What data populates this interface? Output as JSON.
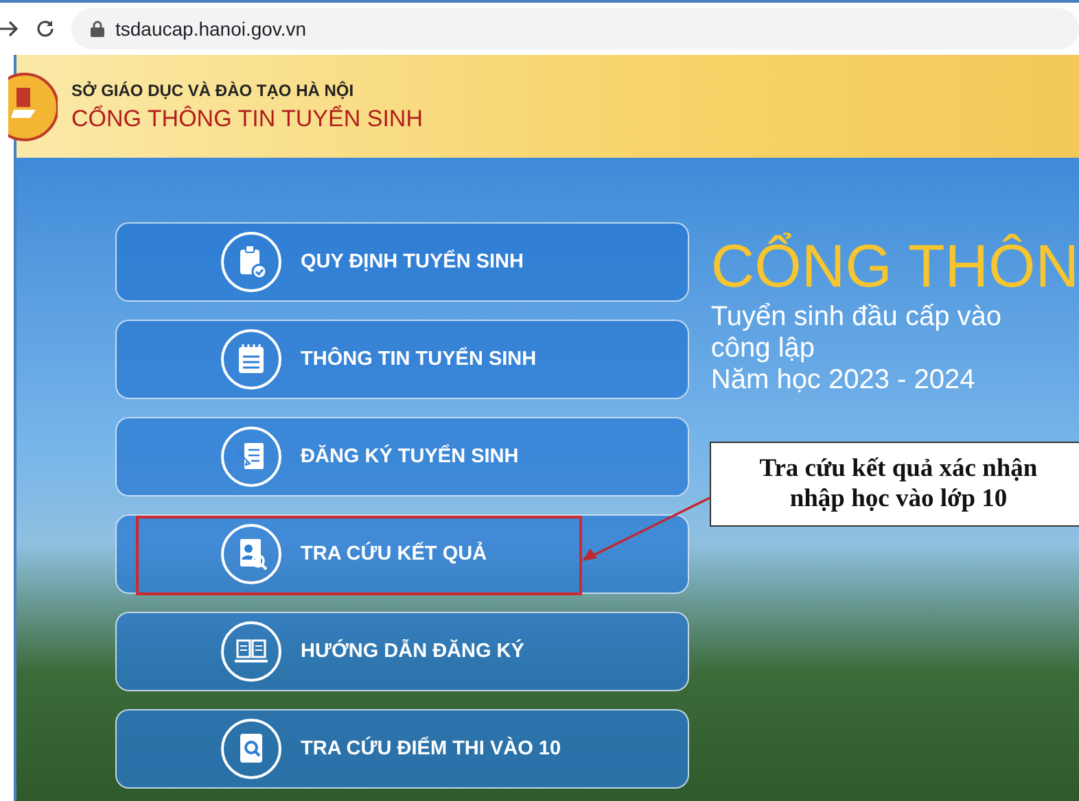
{
  "browser": {
    "url": "tsdaucap.hanoi.gov.vn"
  },
  "header": {
    "department": "SỞ GIÁO DỤC VÀ ĐÀO TẠO HÀ NỘI",
    "portal": "CỔNG THÔNG TIN TUYỂN SINH"
  },
  "menu": [
    {
      "label": "QUY ĐỊNH TUYỂN SINH",
      "highlighted": false
    },
    {
      "label": "THÔNG TIN TUYỂN SINH",
      "highlighted": false
    },
    {
      "label": "ĐĂNG KÝ TUYỂN SINH",
      "highlighted": false
    },
    {
      "label": "TRA CỨU KẾT QUẢ",
      "highlighted": true
    },
    {
      "label": "HƯỚNG DẪN ĐĂNG KÝ",
      "highlighted": false
    },
    {
      "label": "TRA CỨU ĐIỂM THI VÀO 10",
      "highlighted": false
    }
  ],
  "hero": {
    "title": "CỔNG THÔN",
    "subtitle_lines": [
      "Tuyển sinh đầu cấp vào",
      "công lập"
    ],
    "school_year": "Năm học 2023 - 2024"
  },
  "annotation": {
    "lines": [
      "Tra cứu kết quả xác nhận",
      "nhập học vào lớp 10"
    ]
  }
}
